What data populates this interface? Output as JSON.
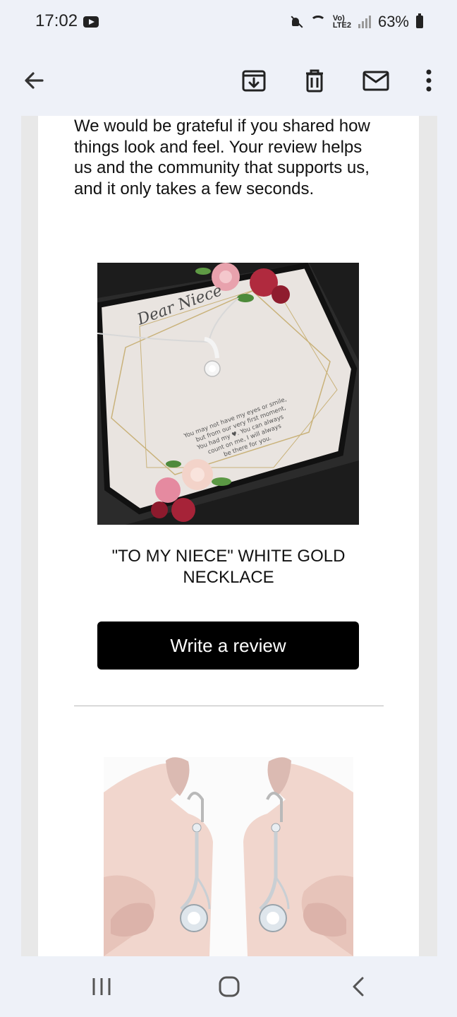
{
  "status_bar": {
    "time": "17:02",
    "lte_label": "Vo)\nLTE2",
    "battery": "63%",
    "icons": [
      "youtube-icon",
      "mute-icon",
      "wifi-icon",
      "signal-icon",
      "battery-icon"
    ]
  },
  "toolbar": {
    "icons": [
      "back-arrow-icon",
      "archive-icon",
      "trash-icon",
      "mail-icon",
      "more-vert-icon"
    ]
  },
  "email": {
    "intro": "We would be grateful if you shared how things look and feel. Your review helps us and the community that supports us, and it only takes a few seconds.",
    "product": {
      "name": "\"TO MY NIECE\" WHITE GOLD NECKLACE",
      "card_heading": "Dear Niece",
      "card_message": "You may not have my eyes or smile, but from our very first moment, You had my ♥. You can always count on me, I will always be there for you."
    },
    "review_button": "Write a review"
  },
  "nav_bar": {
    "icons": [
      "recent-apps-icon",
      "home-icon",
      "back-icon"
    ]
  },
  "colors": {
    "system_bar_bg": "#eef1f8",
    "button_bg": "#000000",
    "button_text": "#ffffff",
    "frame_bg": "#e8e8e8"
  }
}
